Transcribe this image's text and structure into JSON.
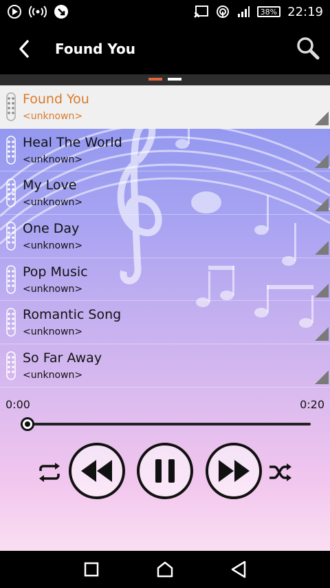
{
  "status_bar": {
    "battery": "38%",
    "time": "22:19",
    "icons": [
      "play-icon",
      "hotspot-icon",
      "notification-icon",
      "cast-icon",
      "wifi-icon",
      "signal-icon",
      "battery-icon"
    ]
  },
  "app_bar": {
    "title": "Found You",
    "back_icon": "chevron-left-icon",
    "search_icon": "search-icon"
  },
  "page_indicator": {
    "pages": 2,
    "active": 0,
    "active_color": "#e8673a"
  },
  "tracks": [
    {
      "title": "Found You",
      "artist": "<unknown>",
      "selected": true
    },
    {
      "title": "Heal The World",
      "artist": "<unknown>",
      "selected": false
    },
    {
      "title": "My Love",
      "artist": "<unknown>",
      "selected": false
    },
    {
      "title": "One Day",
      "artist": "<unknown>",
      "selected": false
    },
    {
      "title": "Pop Music",
      "artist": "<unknown>",
      "selected": false
    },
    {
      "title": "Romantic Song",
      "artist": "<unknown>",
      "selected": false
    },
    {
      "title": "So Far Away",
      "artist": "<unknown>",
      "selected": false
    }
  ],
  "player": {
    "elapsed": "0:00",
    "total": "0:20",
    "progress": 0.0,
    "controls": [
      "repeat-icon",
      "rewind-icon",
      "pause-icon",
      "fast-forward-icon",
      "shuffle-icon"
    ]
  },
  "colors": {
    "accent": "#d97a2b",
    "selected_row": "#f0f0f0"
  },
  "nav_bar": {
    "icons": [
      "recents-icon",
      "home-icon",
      "back-icon"
    ]
  }
}
